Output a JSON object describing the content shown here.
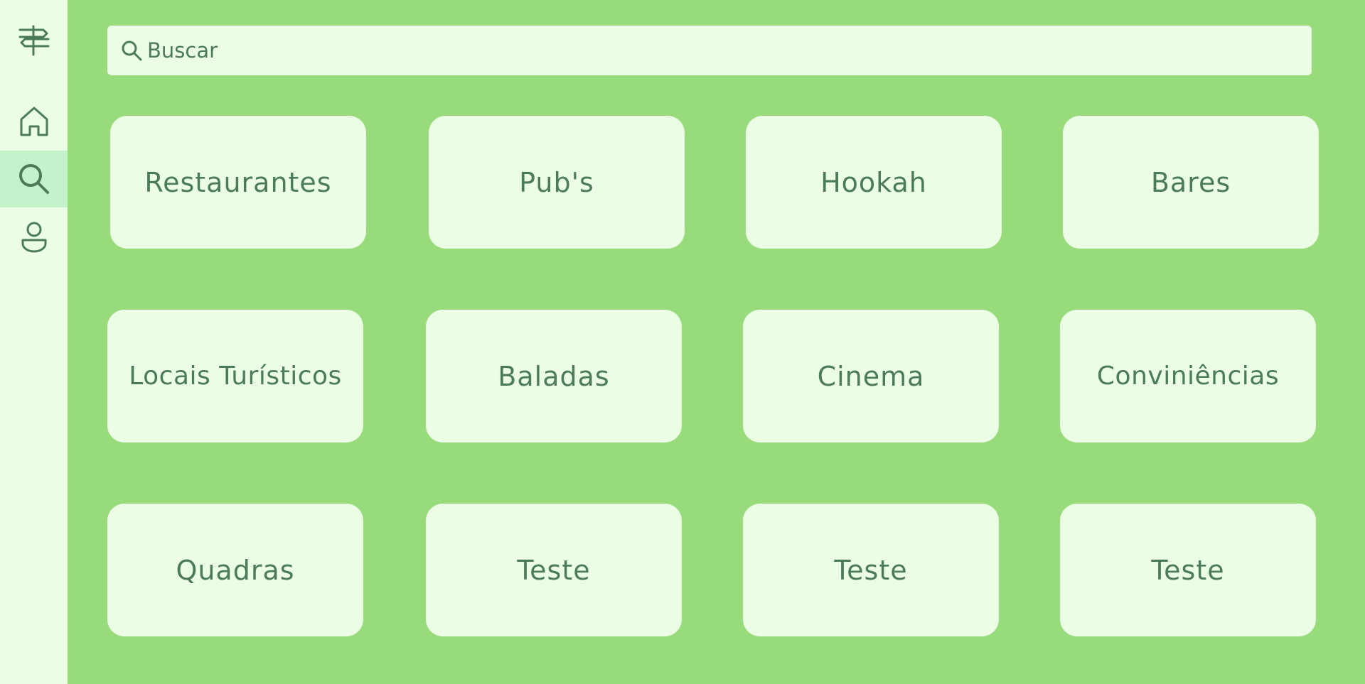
{
  "sidebar": {
    "items": [
      {
        "icon": "signpost-icon",
        "active": false
      },
      {
        "icon": "home-icon",
        "active": false
      },
      {
        "icon": "search-icon",
        "active": true
      },
      {
        "icon": "user-icon",
        "active": false
      }
    ]
  },
  "search": {
    "placeholder": "Buscar"
  },
  "categories": [
    "Restaurantes",
    "Pub's",
    "Hookah",
    "Bares",
    "Locais Turísticos",
    "Baladas",
    "Cinema",
    "Conviniências",
    "Quadras",
    "Teste",
    "Teste",
    "Teste"
  ],
  "colors": {
    "background": "#97db7b",
    "panel": "#ebfde5",
    "active_item": "#c4f3cb",
    "text": "#4b7c57"
  }
}
